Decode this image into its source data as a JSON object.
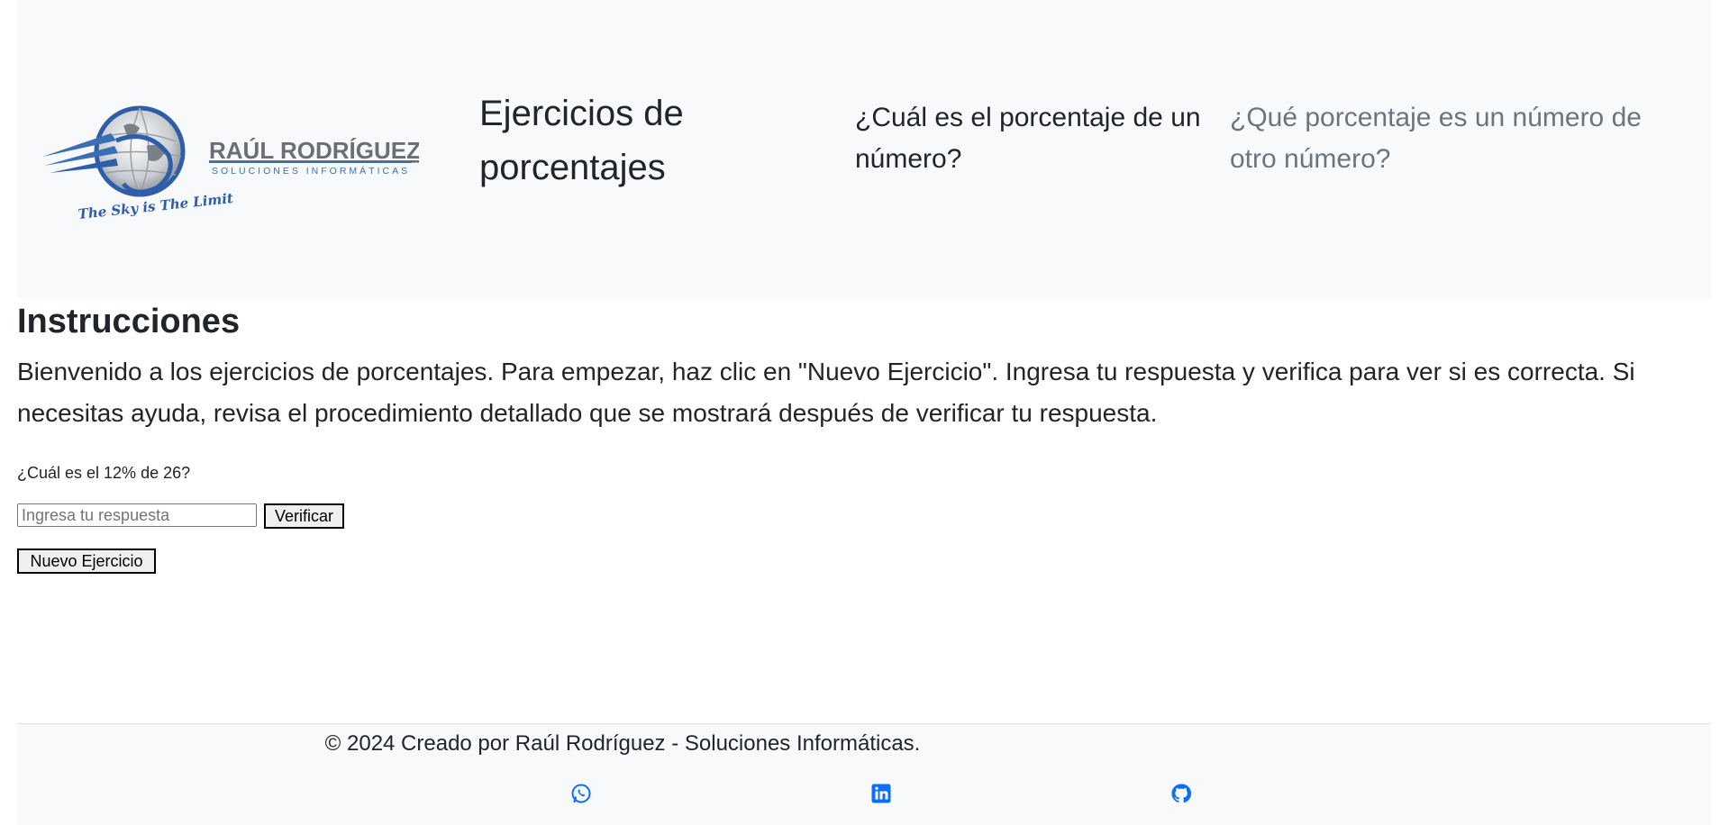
{
  "navbar": {
    "logo": {
      "name": "RAÚL RODRÍGUEZ",
      "tagline": "SOLUCIONES INFORMÁTICAS",
      "slogan": "The Sky is The Limit",
      "icon": "globe-with-wing-logo"
    },
    "title": "Ejercicios de porcentajes",
    "links": [
      {
        "label": "¿Cuál es el porcentaje de un número?",
        "state": "active"
      },
      {
        "label": "¿Qué porcentaje es un número de otro número?",
        "state": "inactive"
      }
    ]
  },
  "main": {
    "heading": "Instrucciones",
    "text": "Bienvenido a los ejercicios de porcentajes. Para empezar, haz clic en \"Nuevo Ejercicio\". Ingresa tu respuesta y verifica para ver si es correcta. Si necesitas ayuda, revisa el procedimiento detallado que se mostrará después de verificar tu respuesta.",
    "question": "¿Cuál es el 12% de 26?",
    "answer_input": {
      "value": "",
      "placeholder": "Ingresa tu respuesta"
    },
    "verify_button": "Verificar",
    "new_exercise_button": "Nuevo Ejercicio"
  },
  "footer": {
    "text": "© 2024 Creado por Raúl Rodríguez - Soluciones Informáticas.",
    "social_icons": [
      "whatsapp-icon",
      "linkedin-icon",
      "github-icon"
    ]
  },
  "colors": {
    "navbar_bg": "#f8f9fa",
    "text": "#212529",
    "muted": "#6c757d",
    "link_blue": "#0d6efd",
    "logo_blue": "#3a6fb8",
    "logo_gray": "#6b6f75"
  }
}
